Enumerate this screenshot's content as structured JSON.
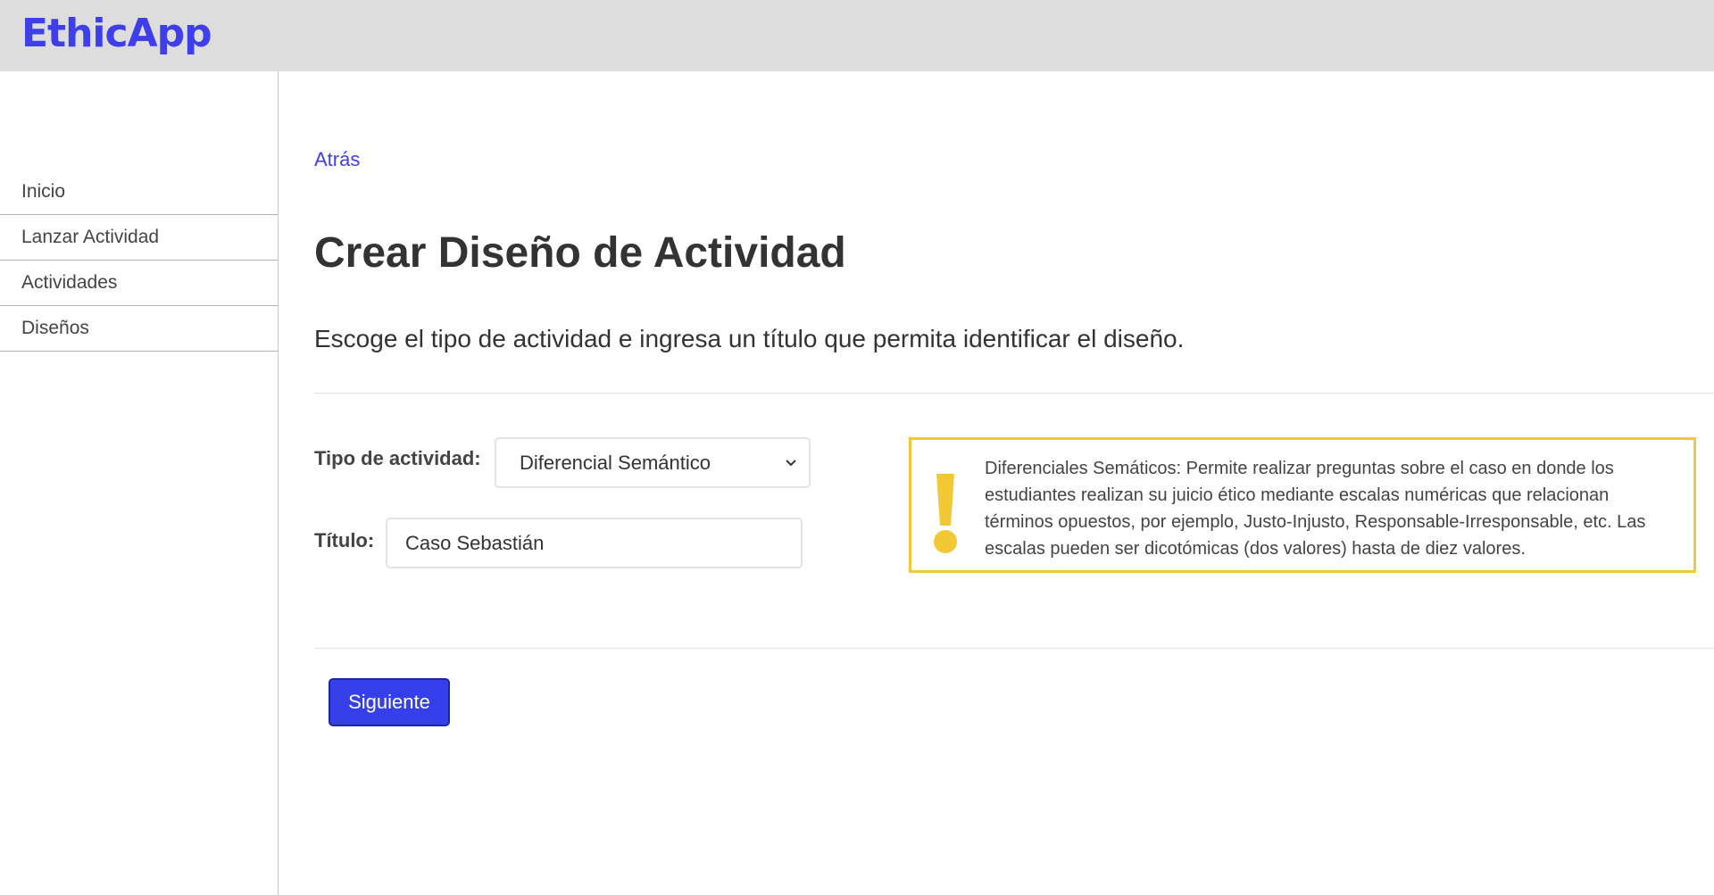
{
  "header": {
    "logo_text": "EthicApp",
    "brand_color": "#3e3fe8",
    "background_color": "#dddddd"
  },
  "sidebar": {
    "items": [
      {
        "label": "Inicio"
      },
      {
        "label": "Lanzar Actividad"
      },
      {
        "label": "Actividades"
      },
      {
        "label": "Diseños"
      }
    ]
  },
  "main": {
    "back_label": "Atrás",
    "title": "Crear Diseño de Actividad",
    "subtitle": "Escoge el tipo de actividad e ingresa un título que permita identificar el diseño.",
    "form": {
      "type_label": "Tipo de actividad:",
      "type_selected": "Diferencial Semántico",
      "title_label": "Título:",
      "title_value": "Caso Sebastián"
    },
    "info": {
      "icon": "exclamation-icon",
      "accent_color": "#f2c835",
      "text": "Diferenciales Semáticos: Permite realizar preguntas sobre el caso en donde los estudiantes realizan su juicio ético mediante escalas numéricas que relacionan términos opuestos, por ejemplo, Justo-Injusto, Responsable-Irresponsable, etc. Las escalas pueden ser dicotómicas (dos valores) hasta de diez valores."
    },
    "next_button_label": "Siguiente",
    "button_color": "#3540eb"
  }
}
